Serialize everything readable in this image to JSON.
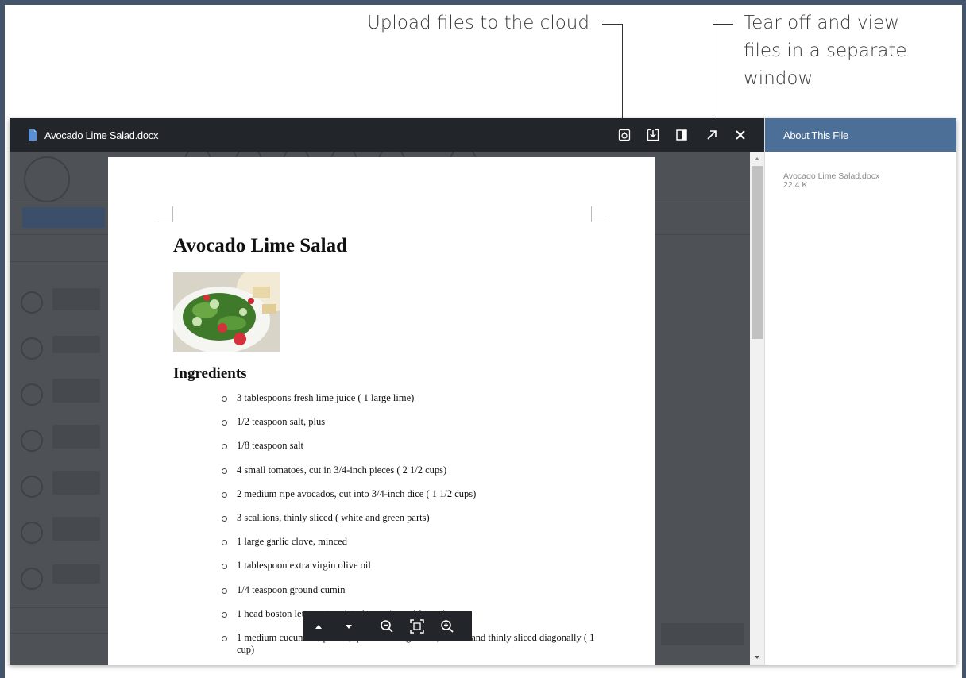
{
  "callouts": {
    "upload": "Upload files to the cloud",
    "tearoff_line1": "Tear off and view",
    "tearoff_line2": "files in a separate",
    "tearoff_line3": "window"
  },
  "viewer": {
    "file_title": "Avocado Lime Salad.docx",
    "toolbar_icons": [
      "upload-cloud-icon",
      "download-icon",
      "panel-toggle-icon",
      "tear-off-icon",
      "close-icon"
    ]
  },
  "document": {
    "title": "Avocado Lime Salad",
    "section_heading": "Ingredients",
    "ingredients": [
      "3 tablespoons fresh lime juice ( 1 large lime)",
      "1/2 teaspoon salt, plus",
      "1/8 teaspoon salt",
      "4 small tomatoes, cut in 3/4-inch pieces ( 2 1/2 cups)",
      "2 medium ripe avocados, cut into 3/4-inch dice ( 1 1/2 cups)",
      "3 scallions, thinly sliced ( white and green parts)",
      "1 large garlic clove, minced",
      "1 tablespoon extra virgin olive oil",
      "1/4 teaspoon ground cumin",
      "1 head boston lettuce, torn into large pieces ( 8 cups)",
      "1 medium cucumber, peeled, quartered lengthwise, seeded and thinly sliced diagonally ( 1 cup)"
    ]
  },
  "zoom_toolbar": {
    "icons": [
      "previous-page-icon",
      "next-page-icon",
      "zoom-out-icon",
      "fit-page-icon",
      "zoom-in-icon"
    ]
  },
  "side_panel": {
    "header": "About This File",
    "file_name": "Avocado Lime Salad.docx",
    "file_size": "22.4 K"
  },
  "colors": {
    "titlebar": "#222529",
    "panel_header": "#4b6f96",
    "frame": "#44546a"
  }
}
